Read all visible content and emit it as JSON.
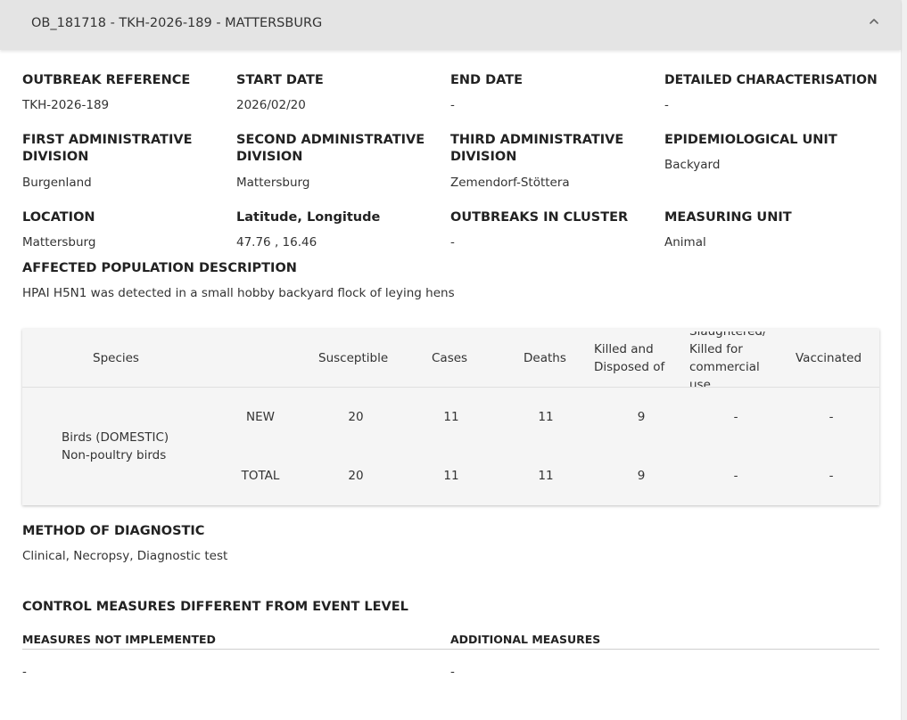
{
  "header": {
    "title": "OB_181718 - TKH-2026-189 - MATTERSBURG",
    "collapse_icon": "chevron-up-icon"
  },
  "fields": {
    "outbreak_reference": {
      "label": "OUTBREAK REFERENCE",
      "value": "TKH-2026-189"
    },
    "start_date": {
      "label": "START DATE",
      "value": "2026/02/20"
    },
    "end_date": {
      "label": "END DATE",
      "value": "-"
    },
    "detailed_characterisation": {
      "label": "DETAILED CHARACTERISATION",
      "value": "-"
    },
    "first_admin_division": {
      "label_line1": "FIRST ADMINISTRATIVE",
      "label_line2": "DIVISION",
      "value": "Burgenland"
    },
    "second_admin_division": {
      "label_line1": "SECOND ADMINISTRATIVE",
      "label_line2": "DIVISION",
      "value": "Mattersburg"
    },
    "third_admin_division": {
      "label_line1": "THIRD ADMINISTRATIVE",
      "label_line2": "DIVISION",
      "value": "Zemendorf-Stöttera"
    },
    "epidemiological_unit": {
      "label": "EPIDEMIOLOGICAL UNIT",
      "value": "Backyard"
    },
    "location": {
      "label": "LOCATION",
      "value": "Mattersburg"
    },
    "lat_long": {
      "label": "Latitude, Longitude",
      "value": "47.76 , 16.46"
    },
    "outbreaks_in_cluster": {
      "label": "OUTBREAKS IN CLUSTER",
      "value": "-"
    },
    "measuring_unit": {
      "label": "MEASURING UNIT",
      "value": "Animal"
    },
    "affected_population": {
      "label": "AFFECTED POPULATION DESCRIPTION",
      "value": "HPAI H5N1 was detected in a small hobby backyard flock of leying hens"
    }
  },
  "table": {
    "headers": {
      "species": "Species",
      "susceptible": "Susceptible",
      "cases": "Cases",
      "deaths": "Deaths",
      "killed_line1": "Killed and",
      "killed_line2": "Disposed of",
      "slaughtered_line1": "Slaughtered/",
      "slaughtered_line2": "Killed for",
      "slaughtered_line3": "commercial",
      "slaughtered_line4": "use",
      "vaccinated": "Vaccinated"
    },
    "species_line1": "Birds (DOMESTIC)",
    "species_line2": "Non-poultry birds",
    "rows": [
      {
        "label": "NEW",
        "susceptible": "20",
        "cases": "11",
        "deaths": "11",
        "killed": "9",
        "slaughtered": "-",
        "vaccinated": "-"
      },
      {
        "label": "TOTAL",
        "susceptible": "20",
        "cases": "11",
        "deaths": "11",
        "killed": "9",
        "slaughtered": "-",
        "vaccinated": "-"
      }
    ]
  },
  "diagnostic": {
    "label": "METHOD OF DIAGNOSTIC",
    "value": "Clinical, Necropsy, Diagnostic test"
  },
  "control_measures": {
    "title": "CONTROL MEASURES DIFFERENT FROM EVENT LEVEL",
    "not_implemented_label": "MEASURES NOT IMPLEMENTED",
    "not_implemented_value": "-",
    "additional_label": "ADDITIONAL MEASURES",
    "additional_value": "-"
  }
}
